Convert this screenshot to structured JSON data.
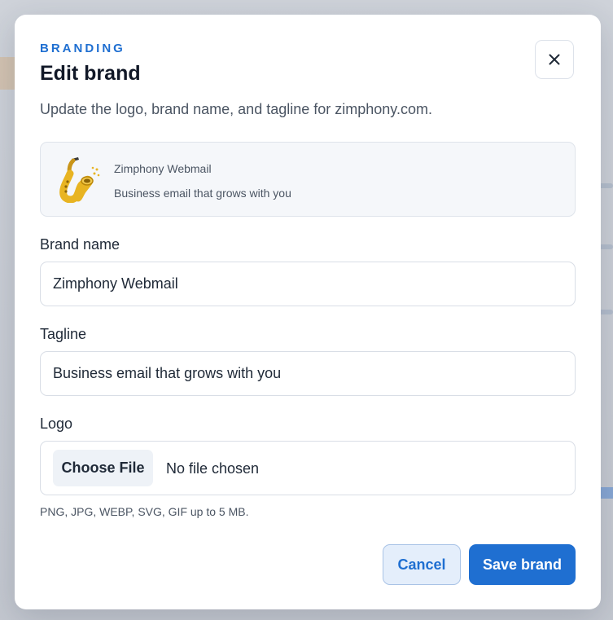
{
  "modal": {
    "eyebrow": "BRANDING",
    "title": "Edit brand",
    "description": "Update the logo, brand name, and tagline for zimphony.com.",
    "close_icon": "close-icon"
  },
  "preview": {
    "logo_icon": "saxophone-logo",
    "name": "Zimphony Webmail",
    "tagline": "Business email that grows with you"
  },
  "form": {
    "brand_name_label": "Brand name",
    "brand_name_value": "Zimphony Webmail",
    "tagline_label": "Tagline",
    "tagline_value": "Business email that grows with you",
    "logo_label": "Logo",
    "choose_file_label": "Choose File",
    "no_file_text": "No file chosen",
    "hint": "PNG, JPG, WEBP, SVG, GIF up to 5 MB."
  },
  "actions": {
    "cancel_label": "Cancel",
    "save_label": "Save brand"
  },
  "colors": {
    "accent": "#1f6fd1",
    "cancel_bg": "#e4eefb",
    "saxophone_gold": "#e8b422"
  }
}
